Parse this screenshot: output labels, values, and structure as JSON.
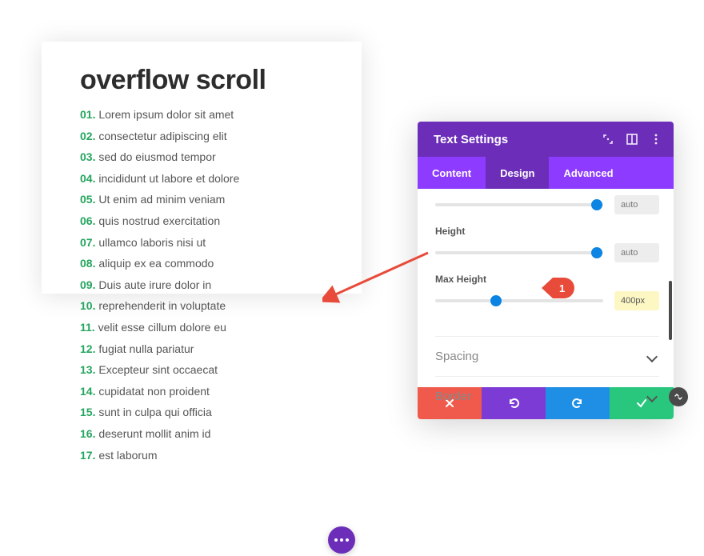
{
  "preview": {
    "heading": "overflow scroll",
    "items": [
      "Lorem ipsum dolor sit amet",
      "consectetur adipiscing elit",
      "sed do eiusmod tempor",
      "incididunt ut labore et dolore",
      "Ut enim ad minim veniam",
      "quis nostrud exercitation",
      "ullamco laboris nisi ut",
      "aliquip ex ea commodo",
      "Duis aute irure dolor in",
      "reprehenderit in voluptate",
      "velit esse cillum dolore eu",
      "fugiat nulla pariatur",
      "Excepteur sint occaecat",
      "cupidatat non proident",
      "sunt in culpa qui officia",
      "deserunt mollit anim id",
      "est laborum"
    ]
  },
  "panel": {
    "title": "Text Settings",
    "tabs": {
      "content": "Content",
      "design": "Design",
      "advanced": "Advanced",
      "active": "design"
    },
    "sliders": {
      "top": {
        "value": "auto",
        "thumb_pct": 96
      },
      "height": {
        "label": "Height",
        "value": "auto",
        "thumb_pct": 96
      },
      "max": {
        "label": "Max Height",
        "value": "400px",
        "thumb_pct": 36,
        "highlight": true
      }
    },
    "accordions": {
      "spacing": "Spacing",
      "border": "Border"
    }
  },
  "annotation": {
    "badge": "1"
  }
}
